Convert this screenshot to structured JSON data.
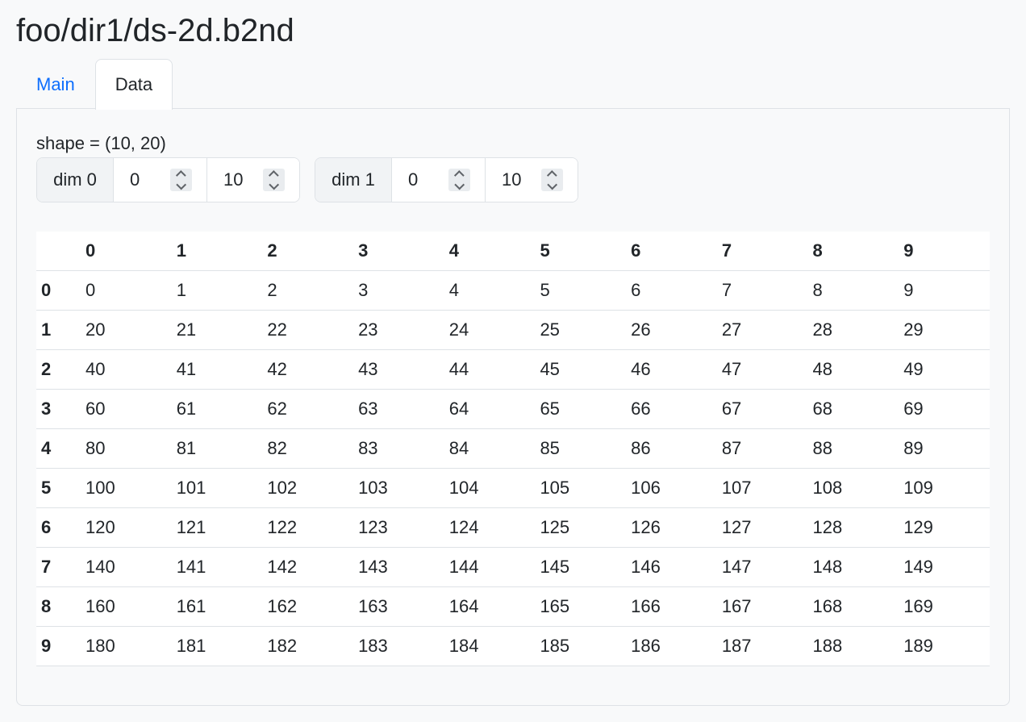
{
  "page": {
    "title": "foo/dir1/ds-2d.b2nd"
  },
  "tabs": [
    {
      "label": "Main",
      "active": false
    },
    {
      "label": "Data",
      "active": true
    }
  ],
  "panel": {
    "shape_label": "shape = (10, 20)",
    "dims": [
      {
        "label": "dim 0",
        "start": "0",
        "stop": "10"
      },
      {
        "label": "dim 1",
        "start": "0",
        "stop": "10"
      }
    ]
  },
  "table": {
    "columns": [
      "0",
      "1",
      "2",
      "3",
      "4",
      "5",
      "6",
      "7",
      "8",
      "9"
    ],
    "rows": [
      {
        "index": "0",
        "cells": [
          "0",
          "1",
          "2",
          "3",
          "4",
          "5",
          "6",
          "7",
          "8",
          "9"
        ]
      },
      {
        "index": "1",
        "cells": [
          "20",
          "21",
          "22",
          "23",
          "24",
          "25",
          "26",
          "27",
          "28",
          "29"
        ]
      },
      {
        "index": "2",
        "cells": [
          "40",
          "41",
          "42",
          "43",
          "44",
          "45",
          "46",
          "47",
          "48",
          "49"
        ]
      },
      {
        "index": "3",
        "cells": [
          "60",
          "61",
          "62",
          "63",
          "64",
          "65",
          "66",
          "67",
          "68",
          "69"
        ]
      },
      {
        "index": "4",
        "cells": [
          "80",
          "81",
          "82",
          "83",
          "84",
          "85",
          "86",
          "87",
          "88",
          "89"
        ]
      },
      {
        "index": "5",
        "cells": [
          "100",
          "101",
          "102",
          "103",
          "104",
          "105",
          "106",
          "107",
          "108",
          "109"
        ]
      },
      {
        "index": "6",
        "cells": [
          "120",
          "121",
          "122",
          "123",
          "124",
          "125",
          "126",
          "127",
          "128",
          "129"
        ]
      },
      {
        "index": "7",
        "cells": [
          "140",
          "141",
          "142",
          "143",
          "144",
          "145",
          "146",
          "147",
          "148",
          "149"
        ]
      },
      {
        "index": "8",
        "cells": [
          "160",
          "161",
          "162",
          "163",
          "164",
          "165",
          "166",
          "167",
          "168",
          "169"
        ]
      },
      {
        "index": "9",
        "cells": [
          "180",
          "181",
          "182",
          "183",
          "184",
          "185",
          "186",
          "187",
          "188",
          "189"
        ]
      }
    ]
  },
  "colors": {
    "link": "#0d6efd",
    "border": "#dee2e6",
    "background": "#f8f9fa"
  },
  "icons": {
    "spinner": "stepper-chevrons-icon"
  }
}
